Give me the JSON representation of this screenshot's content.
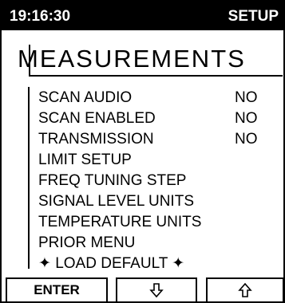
{
  "header": {
    "time": "19:16:30",
    "mode": "SETUP"
  },
  "title": "MEASUREMENTS",
  "menu": [
    {
      "label": "SCAN AUDIO",
      "value": "NO"
    },
    {
      "label": "SCAN ENABLED",
      "value": "NO"
    },
    {
      "label": "TRANSMISSION",
      "value": "NO"
    },
    {
      "label": "LIMIT SETUP"
    },
    {
      "label": "FREQ TUNING STEP"
    },
    {
      "label": "SIGNAL LEVEL UNITS"
    },
    {
      "label": "TEMPERATURE UNITS"
    },
    {
      "label": "PRIOR MENU"
    },
    {
      "label": "✦ LOAD DEFAULT ✦"
    }
  ],
  "buttons": {
    "enter": "ENTER",
    "down_icon": "down-arrow-icon",
    "up_icon": "up-arrow-icon"
  }
}
